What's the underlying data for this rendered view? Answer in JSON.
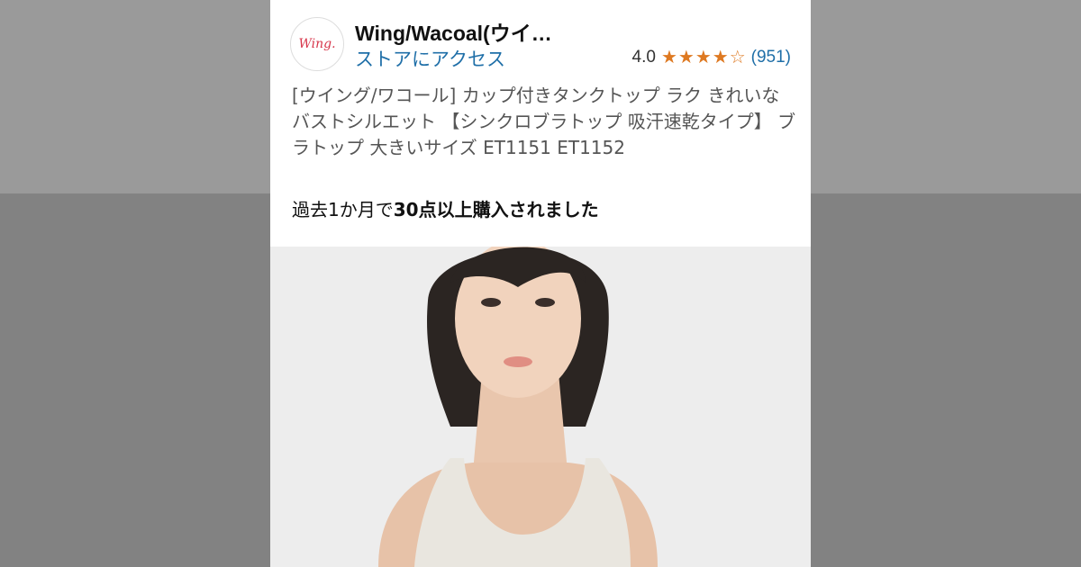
{
  "store": {
    "logo_text": "Wing.",
    "name": "Wing/Wacoal(ウイ…",
    "link_label": "ストアにアクセス",
    "rating_value": "4.0",
    "rating_stars": 4.0,
    "review_count": "(951)"
  },
  "product": {
    "title": "[ウイング/ワコール] カップ付きタンクトップ ラク きれいなバストシルエット 【シンクロブラトップ 吸汗速乾タイプ】 ブラトップ 大きいサイズ ET1151 ET1152",
    "purchase_prefix": "過去1か月で",
    "purchase_bold": "30点以上購入されました"
  },
  "colors": {
    "link": "#1f6fa8",
    "star": "#de7921",
    "logo_red": "#d7354a"
  },
  "icons": {
    "star_full": "star-icon",
    "star_empty": "star-outline-icon"
  }
}
